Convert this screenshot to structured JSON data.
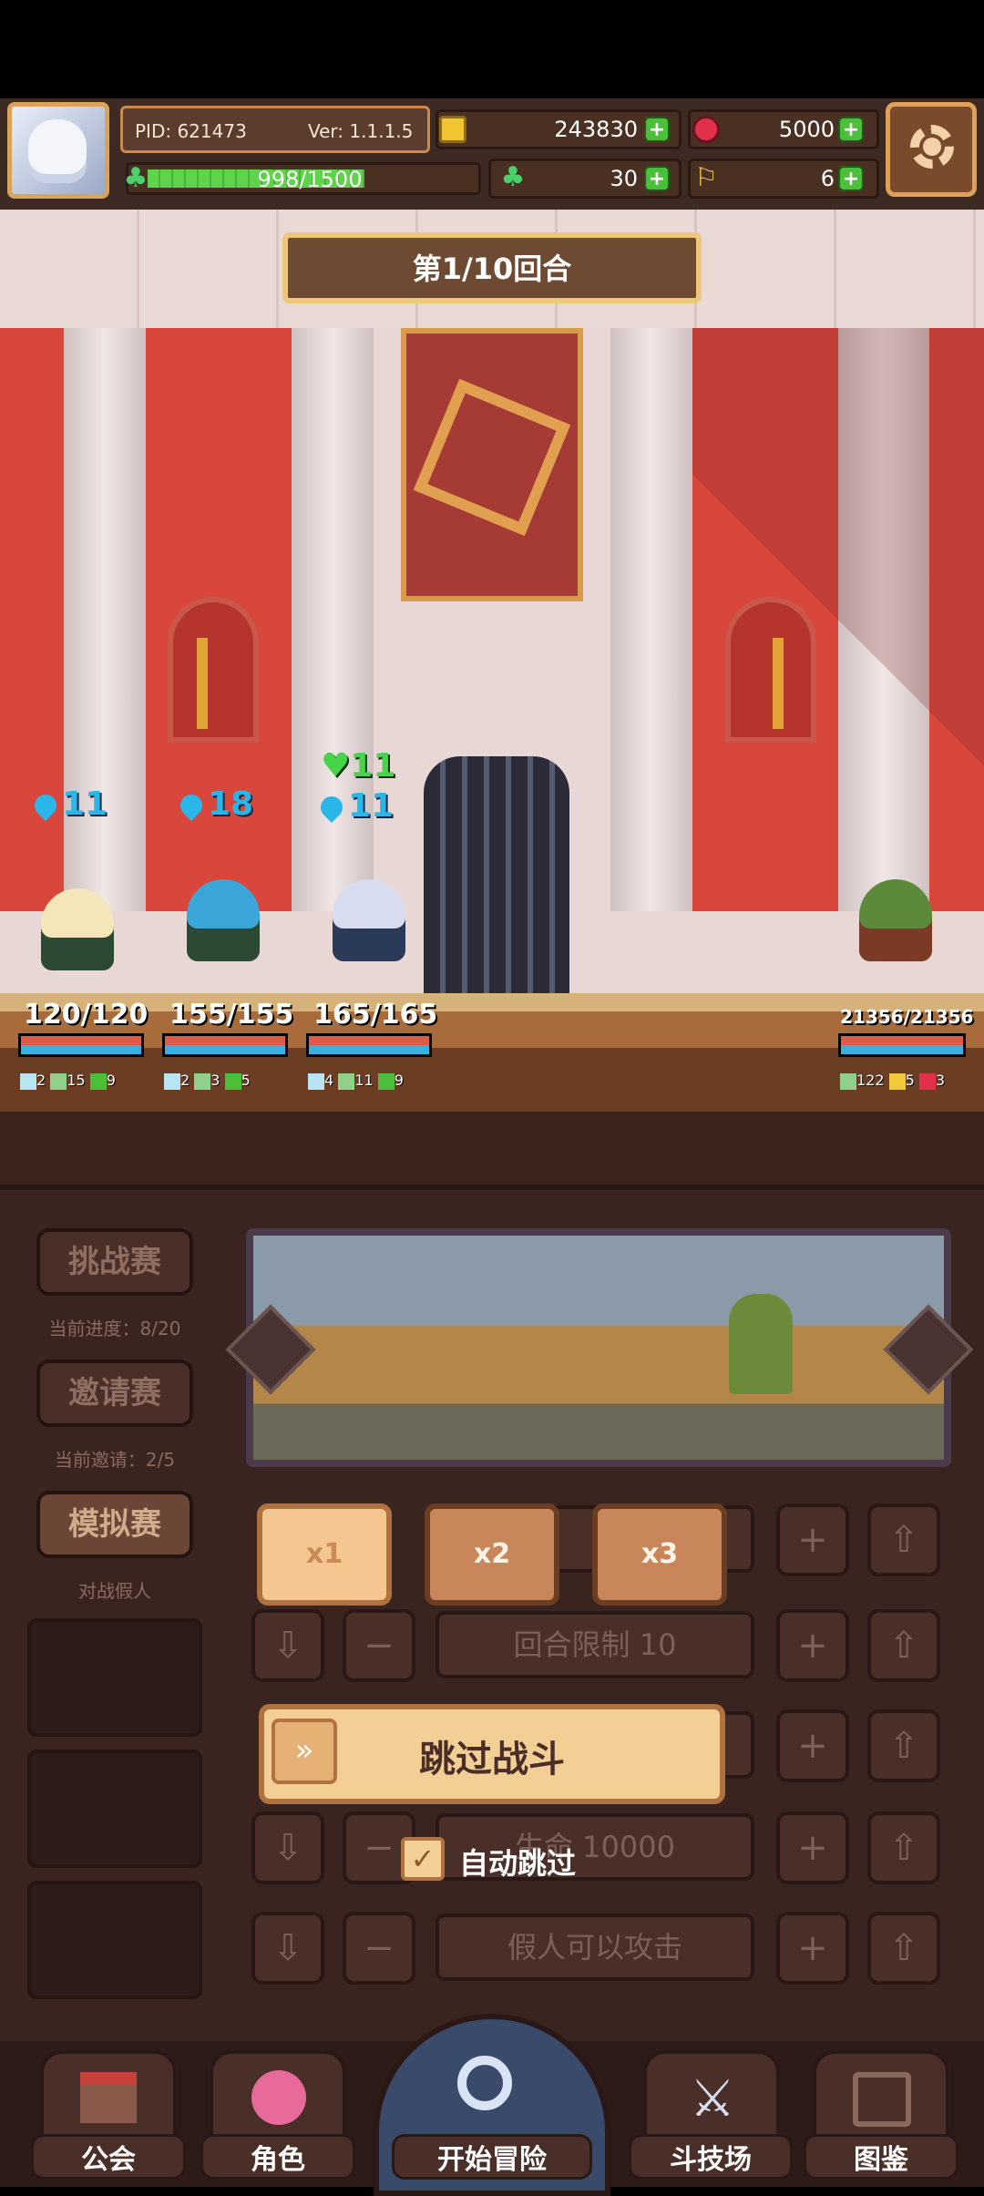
{
  "hud": {
    "pid": "PID: 621473",
    "version": "Ver: 1.1.1.5",
    "gold": "243830",
    "gems": "5000",
    "clover": "30",
    "horn": "6",
    "exp_text": "998/1500",
    "exp_fraction": 0.665
  },
  "battle": {
    "round": "第1/10回合",
    "heroes": [
      {
        "stat": "11",
        "hp": "120/120",
        "mini": [
          "2",
          "15",
          "9"
        ]
      },
      {
        "stat": "18",
        "hp": "155/155",
        "mini": [
          "2",
          "3",
          "5"
        ]
      },
      {
        "stat": "11",
        "heal": "11",
        "hp": "165/165",
        "mini": [
          "4",
          "11",
          "9"
        ]
      }
    ],
    "enemy": {
      "hp": "21356/21356",
      "mini": [
        "122",
        "5",
        "3"
      ]
    }
  },
  "sidebar": {
    "challenge": "挑战赛",
    "challenge_progress": "当前进度：8/20",
    "invite": "邀请赛",
    "invite_progress": "当前邀请：2/5",
    "mock": "模拟赛",
    "mock_desc": "对战假人"
  },
  "controls": {
    "speed": [
      "x1",
      "x2",
      "x3"
    ],
    "round_limit": "回合限制 10",
    "hp_row": "生命 10000",
    "dummy_attack": "假人可以攻击",
    "skip_battle": "跳过战斗",
    "auto_skip": "自动跳过",
    "plus": "+",
    "minus": "−"
  },
  "nav": {
    "guild": "公会",
    "character": "角色",
    "adventure": "开始冒险",
    "arena": "斗技场",
    "codex": "图鉴"
  }
}
